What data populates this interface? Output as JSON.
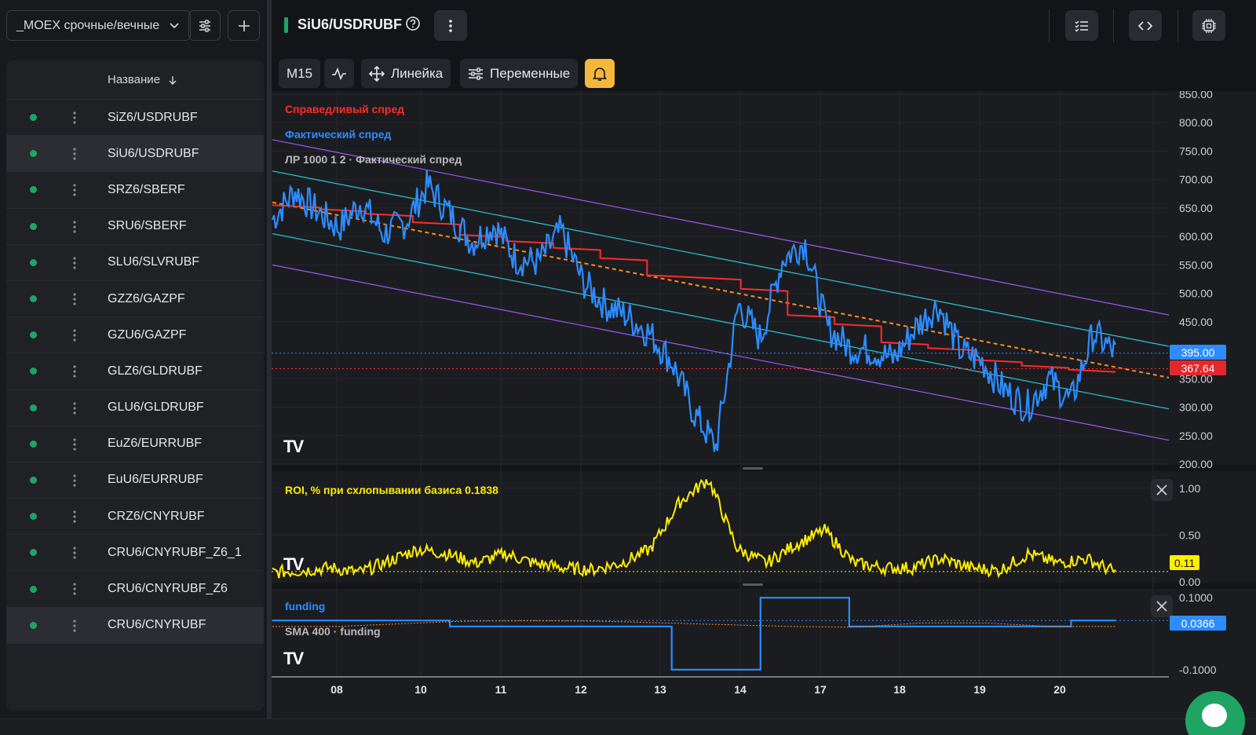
{
  "sidebar": {
    "watchlist_name": "_MOEX срочные/вечные",
    "column_header": "Название",
    "items": [
      {
        "label": "SiZ6/USDRUBF"
      },
      {
        "label": "SiU6/USDRUBF"
      },
      {
        "label": "SRZ6/SBERF"
      },
      {
        "label": "SRU6/SBERF"
      },
      {
        "label": "SLU6/SLVRUBF"
      },
      {
        "label": "GZZ6/GAZPF"
      },
      {
        "label": "GZU6/GAZPF"
      },
      {
        "label": "GLZ6/GLDRUBF"
      },
      {
        "label": "GLU6/GLDRUBF"
      },
      {
        "label": "EuZ6/EURRUBF"
      },
      {
        "label": "EuU6/EURRUBF"
      },
      {
        "label": "CRZ6/CNYRUBF"
      },
      {
        "label": "CRU6/CNYRUBF_Z6_1"
      },
      {
        "label": "CRU6/CNYRUBF_Z6"
      },
      {
        "label": "CRU6/CNYRUBF"
      }
    ],
    "selected_index": 1
  },
  "header": {
    "symbol": "SiU6/USDRUBF"
  },
  "toolbar": {
    "interval": "M15",
    "ruler_label": "Линейка",
    "variables_label": "Переменные"
  },
  "colors": {
    "fair_spread": "#ff2b2b",
    "actual_spread": "#2d8cff",
    "regression_mid": "#ff8c1a",
    "inner_channel": "#28c8d8",
    "outer_channel": "#9b59f5",
    "roi": "#ffee00",
    "funding": "#2d8cff",
    "up_green": "#1fa463"
  },
  "chart_data": [
    {
      "type": "line",
      "pane": "main",
      "series": [
        {
          "name": "Справедливый спред",
          "values": [
            655,
            648,
            640,
            625,
            603,
            592,
            580,
            562,
            532,
            528,
            508,
            462,
            446,
            414,
            404,
            383,
            373,
            366
          ]
        },
        {
          "name": "Фактический спред",
          "values": [
            630,
            680,
            645,
            615,
            660,
            605,
            625,
            690,
            640,
            590,
            620,
            560,
            555,
            610,
            520,
            480,
            460,
            430,
            380,
            290,
            230,
            480,
            420,
            560,
            590,
            440,
            405,
            400,
            385,
            440,
            480,
            400,
            380,
            330,
            300,
            350,
            310,
            430,
            395
          ]
        },
        {
          "name": "ЛР 1000 1 2 · Фактический спред",
          "start": 660,
          "end": 352
        }
      ],
      "x_ticks": [
        "08",
        "10",
        "11",
        "12",
        "13",
        "14",
        "17",
        "18",
        "19",
        "20"
      ],
      "y_ticks": [
        "850.00",
        "800.00",
        "750.00",
        "700.00",
        "650.00",
        "600.00",
        "550.00",
        "500.00",
        "450.00",
        "350.00",
        "300.00",
        "250.00",
        "200.00"
      ],
      "ylim": [
        200,
        850
      ],
      "last_actual": "395.00",
      "last_fair": "367.64"
    },
    {
      "type": "line",
      "pane": "roi",
      "series": [
        {
          "name": "ROI, % при схлопывании базиса 0.1838",
          "values": [
            0.1,
            0.12,
            0.15,
            0.1,
            0.22,
            0.35,
            0.3,
            0.2,
            0.3,
            0.2,
            0.15,
            0.13,
            0.2,
            0.35,
            0.85,
            1.1,
            0.35,
            0.2,
            0.4,
            0.55,
            0.2,
            0.15,
            0.15,
            0.25,
            0.15,
            0.12,
            0.3,
            0.2,
            0.25,
            0.1
          ]
        }
      ],
      "y_ticks": [
        "1.00",
        "0.50",
        "0.00"
      ],
      "ylim": [
        0,
        1.15
      ],
      "last_value": "0.11"
    },
    {
      "type": "line",
      "pane": "funding",
      "series": [
        {
          "name": "funding",
          "values": [
            0.0366,
            0.0366,
            0.0366,
            0.0366,
            0.02,
            0.02,
            0.02,
            0.02,
            0.02,
            -0.1,
            -0.1,
            0.1,
            0.1,
            0.02,
            0.02,
            0.02,
            0.02,
            0.02,
            0.0366
          ]
        },
        {
          "name": "SMA 400 · funding",
          "values": [
            0.02,
            0.02,
            0.028,
            0.035,
            0.036,
            0.035,
            0.03,
            0.025,
            0.02,
            0.018,
            0.03,
            0.03,
            0.02,
            0.02
          ]
        }
      ],
      "y_ticks": [
        "0.1000",
        "-0.1000"
      ],
      "ylim": [
        -0.12,
        0.12
      ],
      "last_value": "0.0366"
    }
  ]
}
